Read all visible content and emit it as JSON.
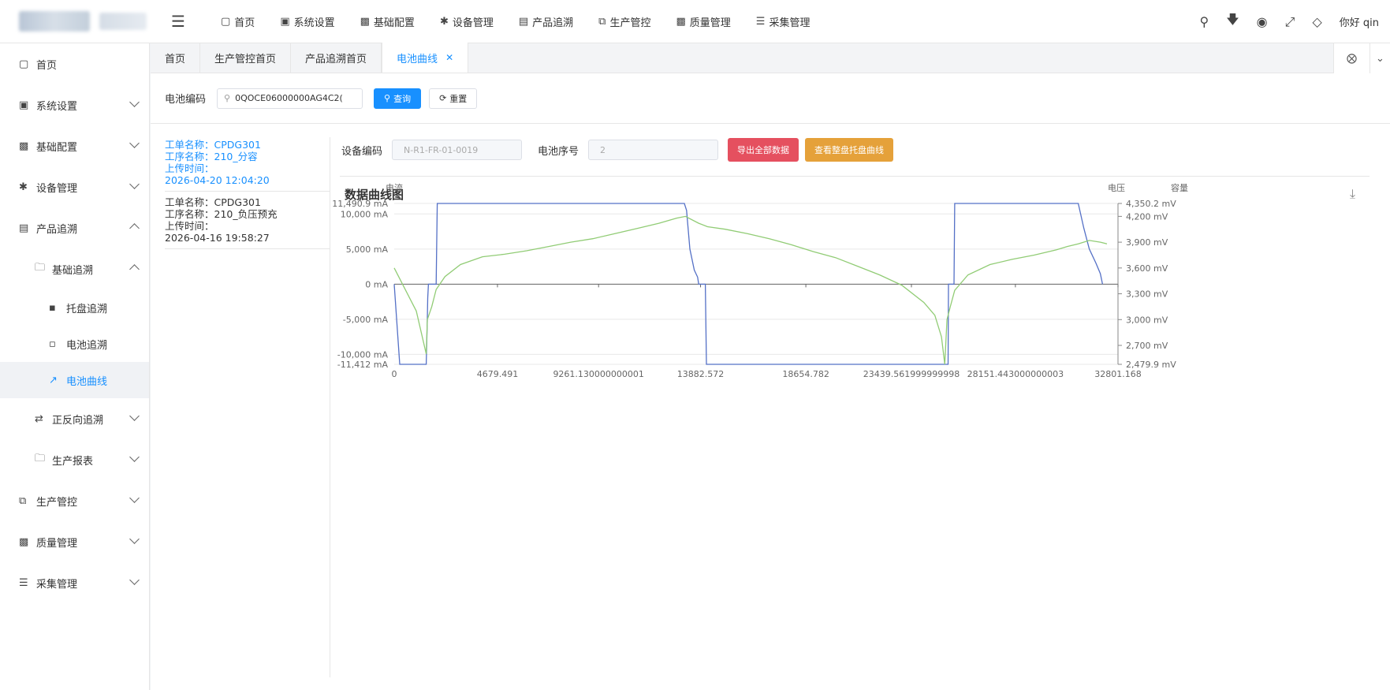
{
  "topnav": {
    "items": [
      {
        "icon": "monitor-icon",
        "label": "首页"
      },
      {
        "icon": "user-card-icon",
        "label": "系统设置"
      },
      {
        "icon": "briefcase-icon",
        "label": "基础配置"
      },
      {
        "icon": "asterisk-icon",
        "label": "设备管理"
      },
      {
        "icon": "server-icon",
        "label": "产品追溯"
      },
      {
        "icon": "clone-icon",
        "label": "生产管控"
      },
      {
        "icon": "briefcase-icon",
        "label": "质量管理"
      },
      {
        "icon": "database-icon",
        "label": "采集管理"
      }
    ],
    "greeting": "你好 qin"
  },
  "sidebar": {
    "items": [
      {
        "label": "首页"
      },
      {
        "label": "系统设置"
      },
      {
        "label": "基础配置"
      },
      {
        "label": "设备管理"
      },
      {
        "label": "产品追溯"
      },
      {
        "label": "基础追溯"
      },
      {
        "label": "托盘追溯"
      },
      {
        "label": "电池追溯"
      },
      {
        "label": "电池曲线"
      },
      {
        "label": "正反向追溯"
      },
      {
        "label": "生产报表"
      },
      {
        "label": "生产管控"
      },
      {
        "label": "质量管理"
      },
      {
        "label": "采集管理"
      }
    ]
  },
  "tabs": [
    "首页",
    "生产管控首页",
    "产品追溯首页",
    "电池曲线"
  ],
  "search": {
    "label": "电池编码",
    "value": "0QOCE06000000AG4C2(",
    "query_label": "查询",
    "reset_label": "重置"
  },
  "records": [
    {
      "order": "工单名称：CPDG301",
      "process": "工序名称：210_分容",
      "upload_label": "上传时间：",
      "upload_time": "2026-04-20 12:04:20"
    },
    {
      "order": "工单名称：CPDG301",
      "process": "工序名称：210_负压预充",
      "upload_label": "上传时间：",
      "upload_time": "2026-04-16 19:58:27"
    }
  ],
  "filters": {
    "device_label": "设备编码",
    "device_value": "N-R1-FR-01-0019",
    "seq_label": "电池序号",
    "seq_value": "2",
    "export_label": "导出全部数据",
    "tray_label": "查看整盘托盘曲线"
  },
  "chart_title": "数据曲线图",
  "colors": {
    "current": "#5470c6",
    "voltage": "#91cc75",
    "capacity": "#cccccc",
    "accent": "#1890ff"
  },
  "chart_data": {
    "type": "line",
    "legend": [
      "电流",
      "电压",
      "容量"
    ],
    "legend_position": "top-center",
    "grid": true,
    "y_left_label": "电流",
    "y_right_label": "电压",
    "y_right2_label": "容量",
    "y_left_range": [
      -11412,
      11490.9
    ],
    "y_left_ticks": [
      "11,490.9 mA",
      "10,000 mA",
      "5,000 mA",
      "0 mA",
      "-5,000 mA",
      "-10,000 mA",
      "-11,412 mA"
    ],
    "y_left_tick_values": [
      11490.9,
      10000,
      5000,
      0,
      -5000,
      -10000,
      -11412
    ],
    "y_right_range": [
      2479.9,
      4350.2
    ],
    "y_right_ticks": [
      "4,350.2 mV",
      "4,200 mV",
      "3,900 mV",
      "3,600 mV",
      "3,300 mV",
      "3,000 mV",
      "2,700 mV",
      "2,479.9 mV"
    ],
    "y_right_tick_values": [
      4350.2,
      4200,
      3900,
      3600,
      3300,
      3000,
      2700,
      2479.9
    ],
    "x_range": [
      0,
      32801.168
    ],
    "x_ticks": [
      "0",
      "4679.491",
      "9261.130000000001",
      "13882.572",
      "18654.782",
      "23439.561999999998",
      "28151.443000000003",
      "32801.168"
    ],
    "x_tick_values": [
      0,
      4679.491,
      9261.13,
      13882.572,
      18654.782,
      23439.562,
      28151.443,
      32801.168
    ],
    "series": [
      {
        "name": "电流",
        "axis": "left",
        "x": [
          0,
          250,
          1450,
          1500,
          1520,
          1550,
          1560,
          1900,
          1950,
          13150,
          13250,
          13400,
          13600,
          13750,
          13800,
          14100,
          14150,
          24950,
          25000,
          25050,
          25100,
          25120,
          25150,
          25200,
          25370,
          25400,
          31000,
          31250,
          31500,
          31800,
          32000,
          32100
        ],
        "y": [
          0,
          -11412,
          -11412,
          -5000,
          -2000,
          0,
          0,
          0,
          11490.9,
          11490.9,
          10500,
          5000,
          2000,
          1000,
          0,
          0,
          -11412,
          -11412,
          -11412,
          -11412,
          -11412,
          0,
          0,
          0,
          0,
          11490.9,
          11490.9,
          8000,
          5000,
          3000,
          1500,
          0
        ]
      },
      {
        "name": "电压",
        "axis": "right",
        "x": [
          0,
          300,
          1000,
          1450,
          1500,
          1700,
          1900,
          2300,
          3000,
          4000,
          5000,
          6000,
          7000,
          8000,
          9000,
          10000,
          11000,
          12000,
          12800,
          13200,
          13800,
          14200,
          15000,
          16000,
          17000,
          18000,
          19000,
          20000,
          21000,
          22000,
          23000,
          24000,
          24500,
          24800,
          24950,
          25050,
          25200,
          25400,
          26000,
          27000,
          28000,
          29000,
          30000,
          30500,
          31000,
          31500,
          32000,
          32300
        ],
        "y": [
          3600,
          3450,
          3100,
          2600,
          3000,
          3150,
          3350,
          3500,
          3640,
          3730,
          3760,
          3800,
          3850,
          3900,
          3940,
          4000,
          4060,
          4120,
          4180,
          4200,
          4120,
          4080,
          4050,
          4000,
          3940,
          3870,
          3790,
          3720,
          3620,
          3520,
          3400,
          3200,
          3050,
          2800,
          2479.9,
          3000,
          3150,
          3340,
          3520,
          3640,
          3700,
          3750,
          3810,
          3850,
          3880,
          3920,
          3900,
          3880
        ]
      }
    ]
  }
}
